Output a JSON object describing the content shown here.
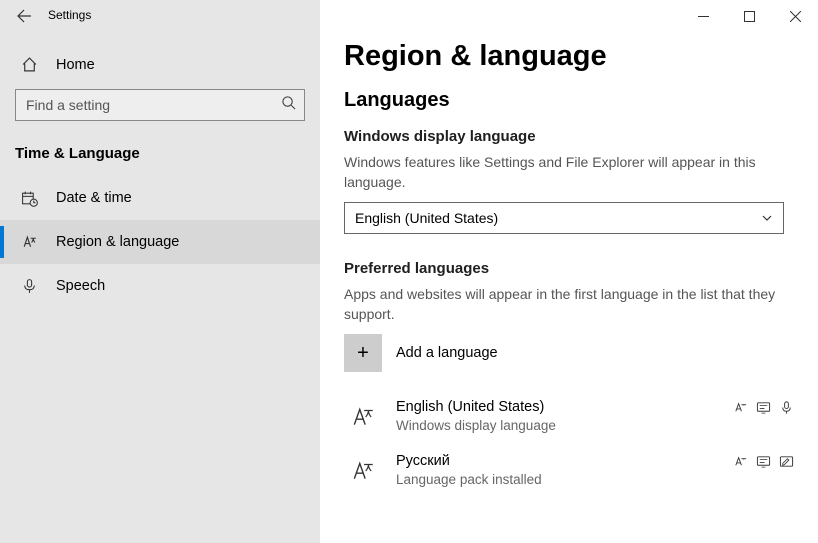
{
  "window": {
    "app_title": "Settings"
  },
  "sidebar": {
    "home_label": "Home",
    "search_placeholder": "Find a setting",
    "category": "Time & Language",
    "items": [
      {
        "label": "Date & time"
      },
      {
        "label": "Region & language"
      },
      {
        "label": "Speech"
      }
    ]
  },
  "content": {
    "page_title": "Region & language",
    "section_languages": "Languages",
    "display": {
      "heading": "Windows display language",
      "desc": "Windows features like Settings and File Explorer will appear in this language.",
      "selected": "English (United States)"
    },
    "preferred": {
      "heading": "Preferred languages",
      "desc": "Apps and websites will appear in the first language in the list that they support.",
      "add_label": "Add a language",
      "items": [
        {
          "name": "English (United States)",
          "sub": "Windows display language",
          "badges": [
            "display",
            "tts",
            "speech"
          ]
        },
        {
          "name": "Русский",
          "sub": "Language pack installed",
          "badges": [
            "display",
            "tts",
            "handwriting"
          ]
        }
      ]
    }
  }
}
